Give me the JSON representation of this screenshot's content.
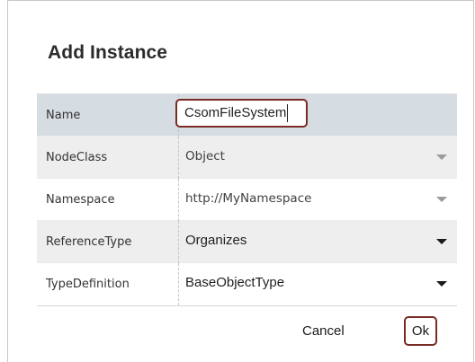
{
  "dialog": {
    "title": "Add Instance"
  },
  "fields": [
    {
      "label": "Name",
      "value": "CsomFileSystem",
      "kind": "text-input"
    },
    {
      "label": "NodeClass",
      "value": "Object",
      "kind": "dropdown-disabled"
    },
    {
      "label": "Namespace",
      "value": "http://MyNamespace",
      "kind": "dropdown-disabled"
    },
    {
      "label": "ReferenceType",
      "value": "Organizes",
      "kind": "dropdown"
    },
    {
      "label": "TypeDefinition",
      "value": "BaseObjectType",
      "kind": "dropdown"
    }
  ],
  "buttons": {
    "cancel": "Cancel",
    "ok": "Ok"
  },
  "icons": {
    "dropdown": "chevron-down-icon"
  },
  "colors": {
    "focus_border": "#7a2b24",
    "header_row": "#d6dde2",
    "shaded_row": "#eeeeee"
  }
}
